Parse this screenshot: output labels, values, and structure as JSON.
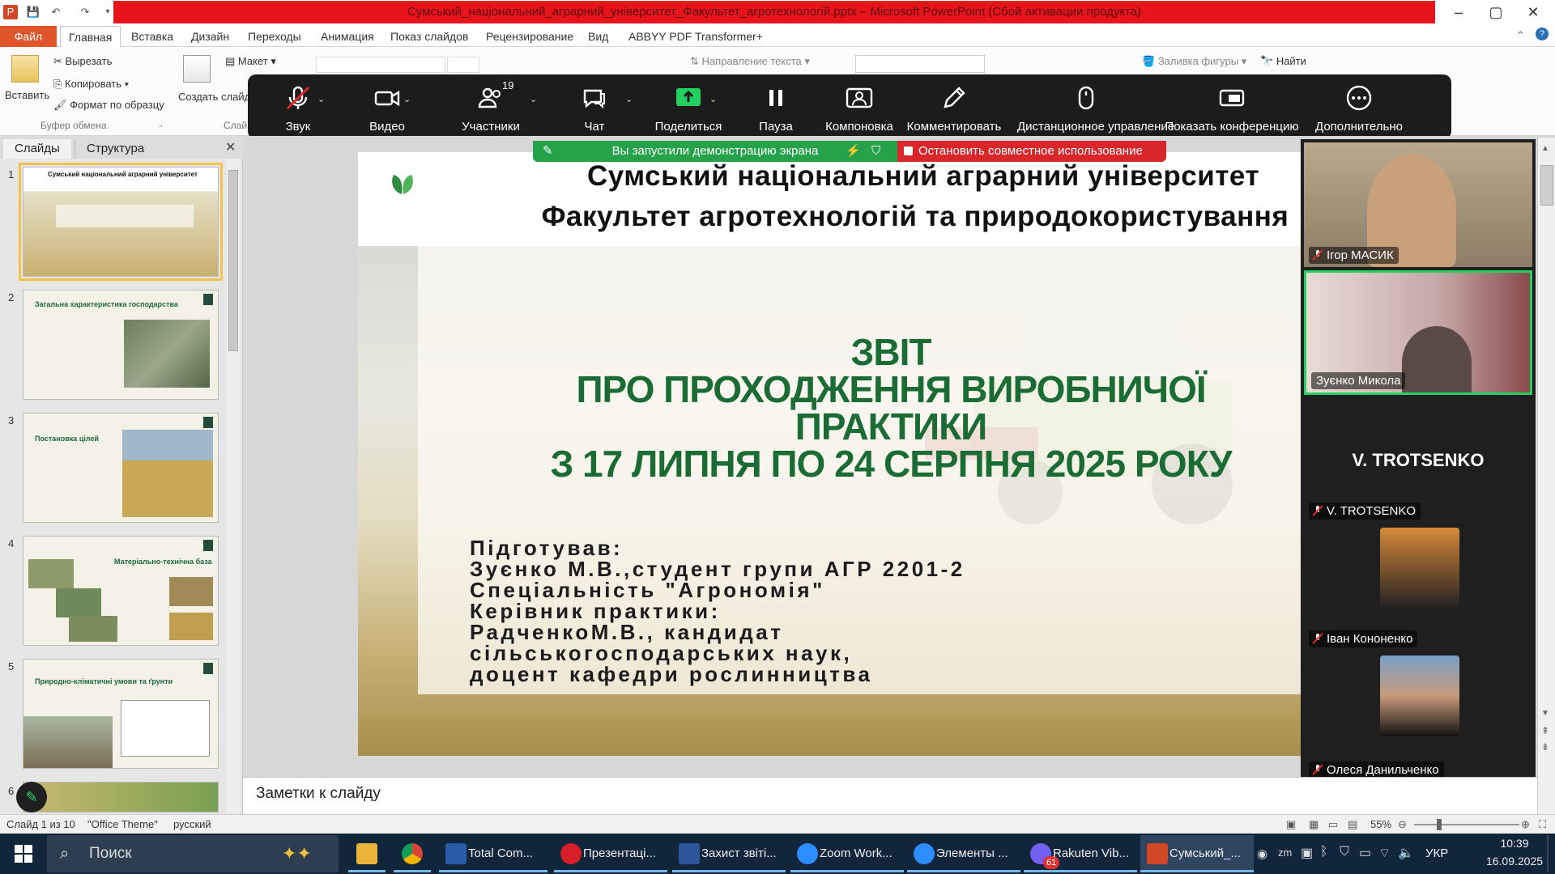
{
  "window": {
    "title": "Сумський_національний_аграрний_університет_Факультет_агротехнологій.pptx  –  Microsoft PowerPoint (Сбой активации продукта)",
    "min": "–",
    "max": "▢",
    "close": "✕"
  },
  "ribbon": {
    "tabs": [
      "Файл",
      "Главная",
      "Вставка",
      "Дизайн",
      "Переходы",
      "Анимация",
      "Показ слайдов",
      "Рецензирование",
      "Вид",
      "ABBYY PDF Transformer+"
    ],
    "paste": "Вставить",
    "cut": "Вырезать",
    "copy": "Копировать",
    "format_painter": "Формат по образцу",
    "clipboard_group": "Буфер обмена",
    "new_slide": "Создать слайд",
    "layout": "Макет",
    "slides_group": "Слай",
    "text_direction": "Направление текста",
    "shape_fill": "Заливка фигуры",
    "find": "Найти"
  },
  "zoom_toolbar": {
    "audio": "Звук",
    "video": "Видео",
    "participants": "Участники",
    "participants_count": "19",
    "chat": "Чат",
    "share": "Поделиться",
    "pause": "Пауза",
    "layout": "Компоновка",
    "annotate": "Комментировать",
    "remote": "Дистанционное управление",
    "show_meeting": "Показать конференцию",
    "more": "Дополнительно"
  },
  "share_banner": {
    "status": "Вы запустили демонстрацию экрана",
    "stop": "Остановить совместное использование"
  },
  "left_pane": {
    "tab_slides": "Слайды",
    "tab_outline": "Структура",
    "close": "✕",
    "thumbnails": [
      {
        "num": "1",
        "title": "Сумський національний аграрний університет"
      },
      {
        "num": "2",
        "title": "Загальна характеристика господарства"
      },
      {
        "num": "3",
        "title": "Постановка цілей"
      },
      {
        "num": "4",
        "title": "Матеріально-технічна база"
      },
      {
        "num": "5",
        "title": "Природно-кліматичні умови та ґрунти"
      },
      {
        "num": "6",
        "title": ""
      }
    ]
  },
  "slide": {
    "university": "Сумський національний аграрний університет",
    "faculty": "Факультет агротехнологій та природокористування",
    "report_1": "ЗВІТ",
    "report_2": "ПРО ПРОХОДЖЕННЯ ВИРОБНИЧОЇ",
    "report_3": "ПРАКТИКИ",
    "report_4": "З 17 ЛИПНЯ ПО 24 СЕРПНЯ 2025 РОКУ",
    "prep_1": "Підготував:",
    "prep_2": "Зуєнко М.В.,студент групи АГР 2201-2",
    "prep_3": "Спеціальність \"Агрономія\"",
    "prep_4": "Керівник практики:",
    "prep_5": "РадченкоМ.В., кандидат",
    "prep_6": "сільськогосподарських наук,",
    "prep_7": "доцент кафедри рослинництва"
  },
  "participants": [
    {
      "name": "Ігор МАСИК"
    },
    {
      "name": "Зуєнко Микола"
    },
    {
      "name": "V. TROTSENKO",
      "display": "V. TROTSENKO"
    },
    {
      "name": "Іван Кононенко"
    },
    {
      "name": "Олеся Данильченко"
    }
  ],
  "notes": {
    "placeholder": "Заметки к слайду"
  },
  "status_bar": {
    "slide": "Слайд 1 из 10",
    "theme": "\"Office Theme\"",
    "lang": "русский",
    "zoom": "55%"
  },
  "taskbar": {
    "search": "Поиск",
    "apps": [
      {
        "label": "Total Com..."
      },
      {
        "label": "Презентаці..."
      },
      {
        "label": "Захист звіті..."
      },
      {
        "label": "Zoom Work..."
      },
      {
        "label": "Элементы ..."
      },
      {
        "label": "Rakuten Vib..."
      },
      {
        "label": "Сумський_..."
      }
    ],
    "viber_badge": "61",
    "lang": "УКР",
    "time": "10:39",
    "date": "16.09.2025"
  },
  "colors": {
    "title_red": "#e8141c",
    "file_tab": "#e0542c",
    "slide_green": "#1b6b35",
    "share_green": "#26a34a",
    "share_red": "#d9262b",
    "zoom_bar": "#1c1c1c",
    "taskbar": "#11253b"
  }
}
